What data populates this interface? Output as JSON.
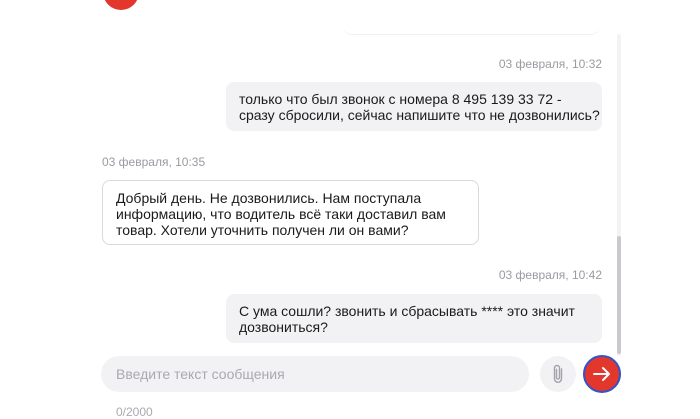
{
  "chat": {
    "messages": [
      {
        "direction": "outgoing",
        "timestamp": "03 февраля, 10:32",
        "lines": [
          "только что был звонок с номера 8 495 139 33 72 -",
          "сразу сбросили, сейчас напишите что не дозвонились?"
        ]
      },
      {
        "direction": "incoming",
        "timestamp": "03 февраля, 10:35",
        "lines": [
          "Добрый день. Не дозвонились. Нам поступала",
          "информацию, что водитель всё таки доставил вам",
          "товар. Хотели уточнить получен ли он вами?"
        ]
      },
      {
        "direction": "outgoing",
        "timestamp": "03 февраля, 10:42",
        "lines": [
          "С ума сошли? звонить и сбрасывать **** это значит",
          "дозвониться?"
        ]
      }
    ]
  },
  "composer": {
    "placeholder": "Введите текст сообщения",
    "value": "",
    "counter": "0/2000"
  },
  "icons": {
    "attach": "paperclip-icon",
    "send": "arrow-right-icon"
  },
  "colors": {
    "accent": "#e3362d",
    "focus_ring": "#2f55c9",
    "outgoing_bubble": "#f2f2f4",
    "incoming_border": "#d9d9de",
    "muted_text": "#9a9aa2"
  }
}
